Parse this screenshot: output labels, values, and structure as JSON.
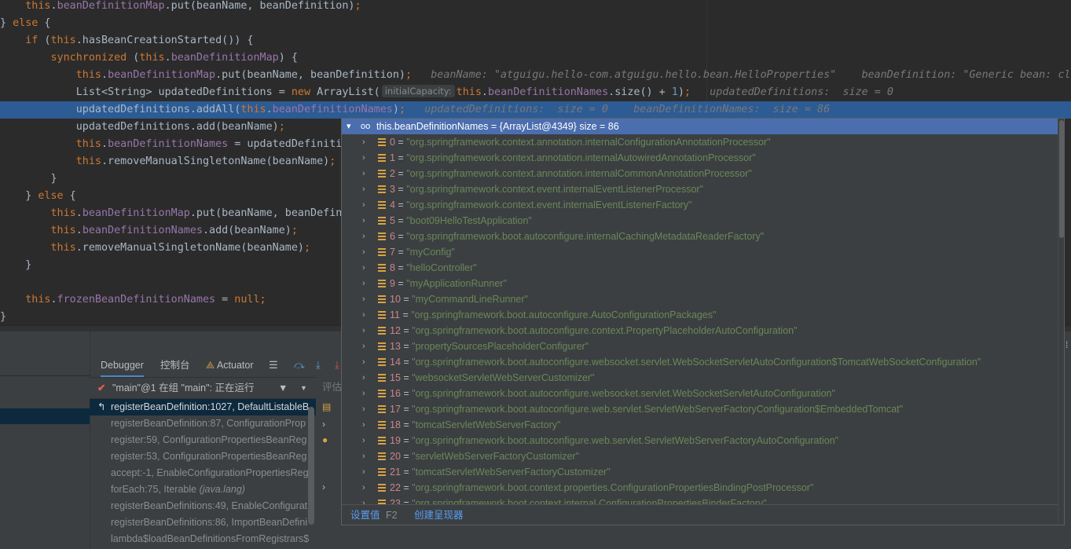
{
  "editor": {
    "lines": [
      {
        "segs": [
          {
            "t": "    "
          },
          {
            "t": "this",
            "c": "k"
          },
          {
            "t": "."
          },
          {
            "t": "beanDefinitionMap",
            "c": "f"
          },
          {
            "t": ".put(beanName, beanDefinition)"
          },
          {
            "t": ";",
            "c": "k"
          }
        ]
      },
      {
        "segs": [
          {
            "t": "} "
          },
          {
            "t": "else",
            "c": "k"
          },
          {
            "t": " {"
          }
        ]
      },
      {
        "segs": [
          {
            "t": "    "
          },
          {
            "t": "if",
            "c": "k"
          },
          {
            "t": " ("
          },
          {
            "t": "this",
            "c": "k"
          },
          {
            "t": ".hasBeanCreationStarted()) {"
          }
        ]
      },
      {
        "segs": [
          {
            "t": "        "
          },
          {
            "t": "synchronized",
            "c": "k"
          },
          {
            "t": " ("
          },
          {
            "t": "this",
            "c": "k"
          },
          {
            "t": "."
          },
          {
            "t": "beanDefinitionMap",
            "c": "f"
          },
          {
            "t": ") {"
          }
        ]
      },
      {
        "segs": [
          {
            "t": "            "
          },
          {
            "t": "this",
            "c": "k"
          },
          {
            "t": "."
          },
          {
            "t": "beanDefinitionMap",
            "c": "f"
          },
          {
            "t": ".put(beanName, beanDefinition)"
          },
          {
            "t": ";",
            "c": "k"
          },
          {
            "t": "   beanName: \"atguigu.hello-com.atguigu.hello.bean.HelloProperties\"    beanDefinition: \"Generic bean: class",
            "c": "hint"
          }
        ]
      },
      {
        "segs": [
          {
            "t": "            List<String> updatedDefinitions = "
          },
          {
            "t": "new",
            "c": "k"
          },
          {
            "t": " ArrayList("
          },
          {
            "t": "initialCapacity:",
            "c": "ihint"
          },
          {
            "t": "this",
            "c": "k"
          },
          {
            "t": "."
          },
          {
            "t": "beanDefinitionNames",
            "c": "f"
          },
          {
            "t": ".size() + "
          },
          {
            "t": "1",
            "c": "n"
          },
          {
            "t": ")"
          },
          {
            "t": ";",
            "c": "k"
          },
          {
            "t": "   updatedDefinitions:  size = 0",
            "c": "hint"
          }
        ]
      },
      {
        "hl": true,
        "segs": [
          {
            "t": "            updatedDefinitions.addAll("
          },
          {
            "t": "this",
            "c": "k"
          },
          {
            "t": "."
          },
          {
            "t": "beanDefinitionNames",
            "c": "f"
          },
          {
            "t": ")"
          },
          {
            "t": ";",
            "c": "k"
          },
          {
            "t": "   updatedDefinitions:  size = 0    beanDefinitionNames:  size = 86",
            "c": "hint"
          }
        ]
      },
      {
        "segs": [
          {
            "t": "            updatedDefinitions.add(beanName)"
          },
          {
            "t": ";",
            "c": "k"
          }
        ]
      },
      {
        "segs": [
          {
            "t": "            "
          },
          {
            "t": "this",
            "c": "k"
          },
          {
            "t": "."
          },
          {
            "t": "beanDefinitionNames",
            "c": "f"
          },
          {
            "t": " = updatedDefiniti"
          }
        ]
      },
      {
        "segs": [
          {
            "t": "            "
          },
          {
            "t": "this",
            "c": "k"
          },
          {
            "t": ".removeManualSingletonName(beanName)"
          },
          {
            "t": ";",
            "c": "k"
          }
        ]
      },
      {
        "segs": [
          {
            "t": "        }"
          }
        ]
      },
      {
        "segs": [
          {
            "t": "    } "
          },
          {
            "t": "else",
            "c": "k"
          },
          {
            "t": " {"
          }
        ]
      },
      {
        "segs": [
          {
            "t": "        "
          },
          {
            "t": "this",
            "c": "k"
          },
          {
            "t": "."
          },
          {
            "t": "beanDefinitionMap",
            "c": "f"
          },
          {
            "t": ".put(beanName, beanDefin"
          }
        ]
      },
      {
        "segs": [
          {
            "t": "        "
          },
          {
            "t": "this",
            "c": "k"
          },
          {
            "t": "."
          },
          {
            "t": "beanDefinitionNames",
            "c": "f"
          },
          {
            "t": ".add(beanName)"
          },
          {
            "t": ";",
            "c": "k"
          }
        ]
      },
      {
        "segs": [
          {
            "t": "        "
          },
          {
            "t": "this",
            "c": "k"
          },
          {
            "t": ".removeManualSingletonName(beanName)"
          },
          {
            "t": ";",
            "c": "k"
          }
        ]
      },
      {
        "segs": [
          {
            "t": "    }"
          }
        ]
      },
      {
        "segs": [
          {
            "t": ""
          }
        ]
      },
      {
        "segs": [
          {
            "t": "    "
          },
          {
            "t": "this",
            "c": "k"
          },
          {
            "t": "."
          },
          {
            "t": "frozenBeanDefinitionNames",
            "c": "f"
          },
          {
            "t": " = "
          },
          {
            "t": "null",
            "c": "k"
          },
          {
            "t": ";",
            "c": "k"
          }
        ]
      },
      {
        "segs": [
          {
            "t": "}"
          }
        ]
      }
    ]
  },
  "tabs": {
    "debugger": "Debugger",
    "console": "控制台",
    "actuator": "Actuator"
  },
  "thread": {
    "label": "\"main\"@1 在组 \"main\": 正在运行"
  },
  "evaluate_placeholder": "评估",
  "frames": [
    {
      "name": "registerBeanDefinition:1027, DefaultListableB",
      "pkg": "",
      "selected": true
    },
    {
      "name": "registerBeanDefinition:87, ConfigurationProp",
      "pkg": ""
    },
    {
      "name": "register:59, ConfigurationPropertiesBeanReg",
      "pkg": ""
    },
    {
      "name": "register:53, ConfigurationPropertiesBeanReg",
      "pkg": ""
    },
    {
      "name": "accept:-1, EnableConfigurationPropertiesReg",
      "pkg": ""
    },
    {
      "name": "forEach:75, Iterable ",
      "pkg": "(java.lang)"
    },
    {
      "name": "registerBeanDefinitions:49, EnableConfigurat",
      "pkg": ""
    },
    {
      "name": "registerBeanDefinitions:86, ImportBeanDefini",
      "pkg": ""
    },
    {
      "name": "lambda$loadBeanDefinitionsFromRegistrars$",
      "pkg": ""
    }
  ],
  "popup": {
    "title": "this.beanDefinitionNames = {ArrayList@4349}  size = 86",
    "items": [
      {
        "i": "0",
        "v": "\"org.springframework.context.annotation.internalConfigurationAnnotationProcessor\""
      },
      {
        "i": "1",
        "v": "\"org.springframework.context.annotation.internalAutowiredAnnotationProcessor\""
      },
      {
        "i": "2",
        "v": "\"org.springframework.context.annotation.internalCommonAnnotationProcessor\""
      },
      {
        "i": "3",
        "v": "\"org.springframework.context.event.internalEventListenerProcessor\""
      },
      {
        "i": "4",
        "v": "\"org.springframework.context.event.internalEventListenerFactory\""
      },
      {
        "i": "5",
        "v": "\"boot09HelloTestApplication\""
      },
      {
        "i": "6",
        "v": "\"org.springframework.boot.autoconfigure.internalCachingMetadataReaderFactory\""
      },
      {
        "i": "7",
        "v": "\"myConfig\""
      },
      {
        "i": "8",
        "v": "\"helloController\""
      },
      {
        "i": "9",
        "v": "\"myApplicationRunner\""
      },
      {
        "i": "10",
        "v": "\"myCommandLineRunner\""
      },
      {
        "i": "11",
        "v": "\"org.springframework.boot.autoconfigure.AutoConfigurationPackages\""
      },
      {
        "i": "12",
        "v": "\"org.springframework.boot.autoconfigure.context.PropertyPlaceholderAutoConfiguration\""
      },
      {
        "i": "13",
        "v": "\"propertySourcesPlaceholderConfigurer\""
      },
      {
        "i": "14",
        "v": "\"org.springframework.boot.autoconfigure.websocket.servlet.WebSocketServletAutoConfiguration$TomcatWebSocketConfiguration\""
      },
      {
        "i": "15",
        "v": "\"websocketServletWebServerCustomizer\""
      },
      {
        "i": "16",
        "v": "\"org.springframework.boot.autoconfigure.websocket.servlet.WebSocketServletAutoConfiguration\""
      },
      {
        "i": "17",
        "v": "\"org.springframework.boot.autoconfigure.web.servlet.ServletWebServerFactoryConfiguration$EmbeddedTomcat\""
      },
      {
        "i": "18",
        "v": "\"tomcatServletWebServerFactory\""
      },
      {
        "i": "19",
        "v": "\"org.springframework.boot.autoconfigure.web.servlet.ServletWebServerFactoryAutoConfiguration\""
      },
      {
        "i": "20",
        "v": "\"servletWebServerFactoryCustomizer\""
      },
      {
        "i": "21",
        "v": "\"tomcatServletWebServerFactoryCustomizer\""
      },
      {
        "i": "22",
        "v": "\"org.springframework.boot.context.properties.ConfigurationPropertiesBindingPostProcessor\""
      },
      {
        "i": "23",
        "v": "\"org.springframework.boot.context.internal.ConfigurationPropertiesBinderFactory\""
      }
    ],
    "footer": {
      "set_value": "设置值",
      "set_value_key": "F2",
      "create_renderer": "创建呈现器"
    }
  }
}
